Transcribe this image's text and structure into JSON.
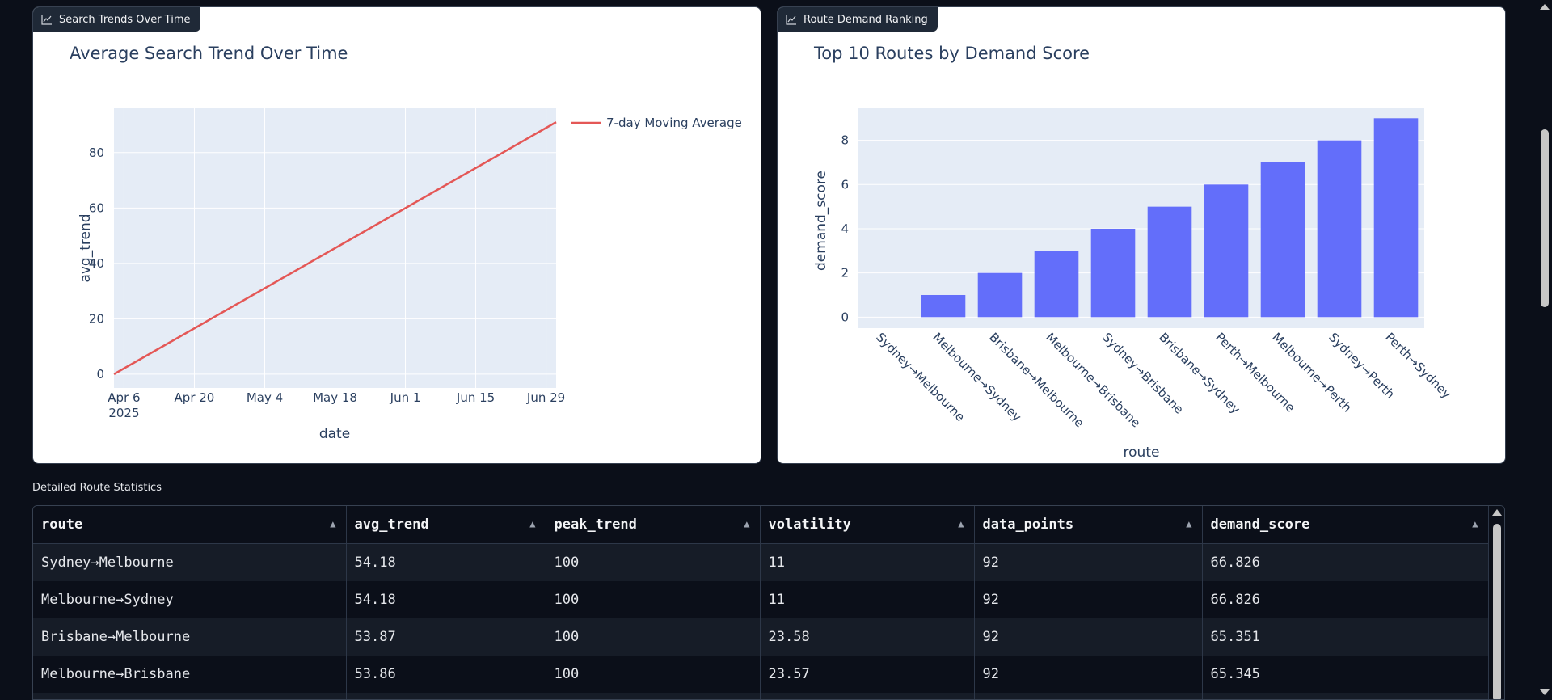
{
  "panels": {
    "left_tag": "Search Trends Over Time",
    "right_tag": "Route Demand Ranking",
    "tag_icon": "chart-icon"
  },
  "chart_data": [
    {
      "type": "line",
      "title": "Average Search Trend Over Time",
      "xlabel": "date",
      "ylabel": "avg_trend",
      "x": [
        "2025-04-04",
        "2025-07-01"
      ],
      "series": [
        {
          "name": "7-day Moving Average",
          "x": [
            "2025-04-04",
            "2025-07-01"
          ],
          "values": [
            0,
            91
          ],
          "color": "#e45756"
        }
      ],
      "x_ticks": [
        "Apr 6",
        "Apr 20",
        "May 4",
        "May 18",
        "Jun 1",
        "Jun 15",
        "Jun 29"
      ],
      "x_tick_dates": [
        "2025-04-06",
        "2025-04-20",
        "2025-05-04",
        "2025-05-18",
        "2025-06-01",
        "2025-06-15",
        "2025-06-29"
      ],
      "x_year_label": "2025",
      "y_ticks": [
        "0",
        "20",
        "40",
        "60",
        "80"
      ],
      "y_tick_values": [
        0,
        20,
        40,
        60,
        80
      ],
      "ylim": [
        -5,
        96
      ],
      "xlim": [
        "2025-04-04",
        "2025-07-01"
      ],
      "grid": true,
      "legend": "right"
    },
    {
      "type": "bar",
      "title": "Top 10 Routes by Demand Score",
      "xlabel": "route",
      "ylabel": "demand_score",
      "categories": [
        "Sydney→Melbourne",
        "Melbourne→Sydney",
        "Brisbane→Melbourne",
        "Melbourne→Brisbane",
        "Sydney→Brisbane",
        "Brisbane→Sydney",
        "Perth→Melbourne",
        "Melbourne→Perth",
        "Sydney→Perth",
        "Perth→Sydney"
      ],
      "values": [
        0,
        1,
        2,
        3,
        4,
        5,
        6,
        7,
        8,
        9
      ],
      "y_ticks": [
        "0",
        "2",
        "4",
        "6",
        "8"
      ],
      "y_tick_values": [
        0,
        2,
        4,
        6,
        8
      ],
      "ylim": [
        -0.5,
        9.45
      ],
      "bar_color": "#636efa",
      "grid": true
    }
  ],
  "table": {
    "label": "Detailed Route Statistics",
    "headers": [
      "route",
      "avg_trend",
      "peak_trend",
      "volatility",
      "data_points",
      "demand_score"
    ],
    "rows": [
      [
        "Sydney→Melbourne",
        "54.18",
        "100",
        "11",
        "92",
        "66.826"
      ],
      [
        "Melbourne→Sydney",
        "54.18",
        "100",
        "11",
        "92",
        "66.826"
      ],
      [
        "Brisbane→Melbourne",
        "53.87",
        "100",
        "23.58",
        "92",
        "65.351"
      ],
      [
        "Melbourne→Brisbane",
        "53.86",
        "100",
        "23.57",
        "92",
        "65.345"
      ],
      [
        "",
        "",
        "",
        "",
        "",
        ""
      ]
    ],
    "sort_icon": "sort-arrow-icon"
  },
  "colors": {
    "page_bg": "#0b0f19",
    "plot_bg": "#e5ecf6",
    "line": "#e45756",
    "bar": "#636efa",
    "text": "#2a3f5f"
  }
}
